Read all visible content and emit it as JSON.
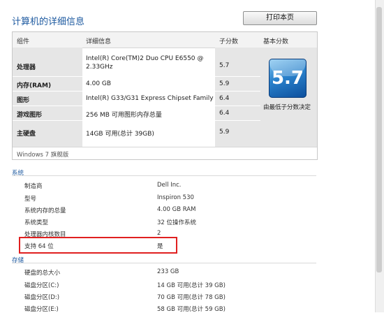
{
  "header": {
    "title": "计算机的详细信息",
    "print_label": "打印本页"
  },
  "score_table": {
    "columns": [
      "组件",
      "详细信息",
      "子分数",
      "基本分数"
    ],
    "rows": [
      {
        "component": "处理器",
        "details_1": "Intel(R) Core(TM)2 Duo CPU E6550 @",
        "details_2": "2.33GHz",
        "subscore": "5.7"
      },
      {
        "component": "内存(RAM)",
        "details_1": "4.00 GB",
        "details_2": "",
        "subscore": "5.9"
      },
      {
        "component": "图形",
        "details_1": "Intel(R) G33/G31 Express Chipset Family",
        "details_2": "",
        "subscore": "6.4"
      },
      {
        "component": "游戏图形",
        "details_1": "256 MB 可用图形内存总量",
        "details_2": "",
        "subscore": "6.4"
      },
      {
        "component": "主硬盘",
        "details_1": "14GB 可用(总计 39GB)",
        "details_2": "",
        "subscore": "5.9"
      }
    ],
    "base_score": "5.7",
    "base_note": "由最低子分数决定",
    "edition": "Windows 7 旗舰版"
  },
  "system": {
    "label": "系统",
    "items": [
      {
        "key": "制造商",
        "value": "Dell Inc."
      },
      {
        "key": "型号",
        "value": "Inspiron 530"
      },
      {
        "key": "系统内存的总量",
        "value": "4.00 GB RAM"
      },
      {
        "key": "系统类型",
        "value": "32 位操作系统"
      },
      {
        "key": "处理器内核数目",
        "value": "2"
      },
      {
        "key": "支持 64 位",
        "value": "是"
      }
    ]
  },
  "storage": {
    "label": "存储",
    "items": [
      {
        "key": "硬盘的总大小",
        "value": "233 GB"
      },
      {
        "key": "磁盘分区(C:)",
        "value": "14 GB 可用(总计 39 GB)"
      },
      {
        "key": "磁盘分区(D:)",
        "value": "70 GB 可用(总计 78 GB)"
      },
      {
        "key": "磁盘分区(E:)",
        "value": "58 GB 可用(总计 59 GB)"
      }
    ]
  },
  "colors": {
    "accent": "#1e5aa0",
    "highlight": "#e02020"
  }
}
